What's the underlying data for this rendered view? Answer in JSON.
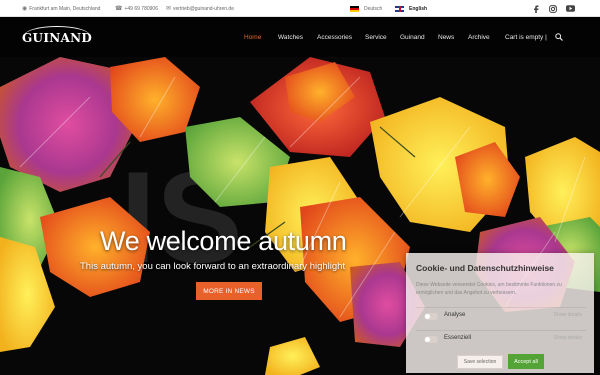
{
  "topbar": {
    "location": "Frankfurt am Main, Deutschland",
    "phone": "+49 69 780906",
    "email": "vertrieb@guinand-uhren.de",
    "lang_de": "Deutsch",
    "lang_en": "English"
  },
  "header": {
    "logo": "GUINAND",
    "nav": [
      "Home",
      "Watches",
      "Accessories",
      "Service",
      "Guinand",
      "News",
      "Archive",
      "Cart is empty |"
    ]
  },
  "hero": {
    "title": "We welcome autumn",
    "subtitle": "This autumn, you can look forward to an extraordinary highlight",
    "cta": "MORE IN NEWS"
  },
  "cookie": {
    "title": "Cookie- und Datenschutzhinweise",
    "description": "Diese Webseite verwendet Cookies, um bestimmte Funktionen zu ermöglichen und das Angebot zu verbessern.",
    "options": [
      {
        "label": "Analyse",
        "link": "Show details"
      },
      {
        "label": "Essenziell",
        "link": "Show details"
      }
    ],
    "save_label": "Save selection",
    "accept_label": "Accept all"
  },
  "colors": {
    "accent": "#e8602a",
    "nav_active": "#e06a2c",
    "accept_green": "#53a336"
  },
  "icons": [
    "location-pin-icon",
    "phone-icon",
    "mail-icon",
    "facebook-icon",
    "instagram-icon",
    "youtube-icon",
    "search-icon"
  ]
}
